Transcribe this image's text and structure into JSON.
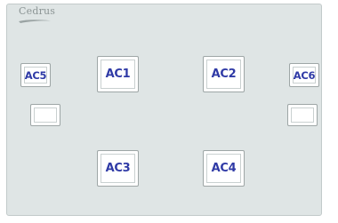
{
  "brand": {
    "logo_text": "Cedrus"
  },
  "buttons": {
    "ac5": "AC5",
    "ac1": "AC1",
    "ac2": "AC2",
    "ac6": "AC6",
    "ac3": "AC3",
    "ac4": "AC4"
  },
  "colors": {
    "panel_bg": "#dfe5e5",
    "label_blue": "#2f3aa6",
    "logo_gray": "#8c9595"
  }
}
